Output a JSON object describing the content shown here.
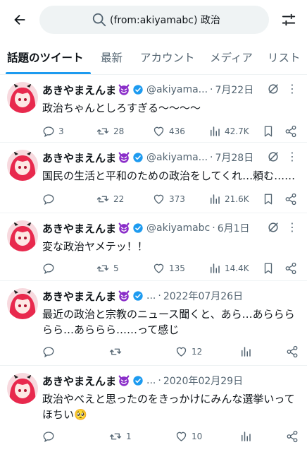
{
  "header": {
    "search_query": "(from:akiyamabc) 政治"
  },
  "tabs": [
    "話題のツイート",
    "最新",
    "アカウント",
    "メディア",
    "リスト"
  ],
  "tweets": [
    {
      "user": "あきやまえんま",
      "handle": "@akiyama...",
      "dot": "·",
      "date": "7月22日",
      "text": "政治ちゃんとしろすぎる〜〜〜〜",
      "replies": "3",
      "retweets": "28",
      "likes": "436",
      "views": "42.7K"
    },
    {
      "user": "あきやまえんま",
      "handle": "@akiyama...",
      "dot": "·",
      "date": "7月28日",
      "text": "国民の生活と平和のための政治をしてくれ…頼む……",
      "replies": "",
      "retweets": "22",
      "likes": "373",
      "views": "21.6K"
    },
    {
      "user": "あきやまえんま",
      "handle": "@akiyamabc",
      "dot": "·",
      "date": "6月1日",
      "text": "変な政治ヤメテッ！！",
      "replies": "",
      "retweets": "5",
      "likes": "135",
      "views": "14.4K"
    },
    {
      "user": "あきやまえんま",
      "handle": "...",
      "dot": "·",
      "date": "2022年07月26日",
      "text": "最近の政治と宗教のニュース聞くと、あら…あららららら…あららら……って感じ",
      "replies": "",
      "retweets": "",
      "likes": "12",
      "views": ""
    },
    {
      "user": "あきやまえんま",
      "handle": "...",
      "dot": "·",
      "date": "2020年02月29日",
      "text": "政治やべえと思ったのをきっかけにみんな選挙いってほちい🥺",
      "replies": "",
      "retweets": "1",
      "likes": "10",
      "views": ""
    }
  ],
  "colors": {
    "accent": "#1d9bf0",
    "text": "#0f1419",
    "muted": "#536471",
    "devil": "#8b2fc9",
    "avatar_hair": "#e8294d"
  }
}
